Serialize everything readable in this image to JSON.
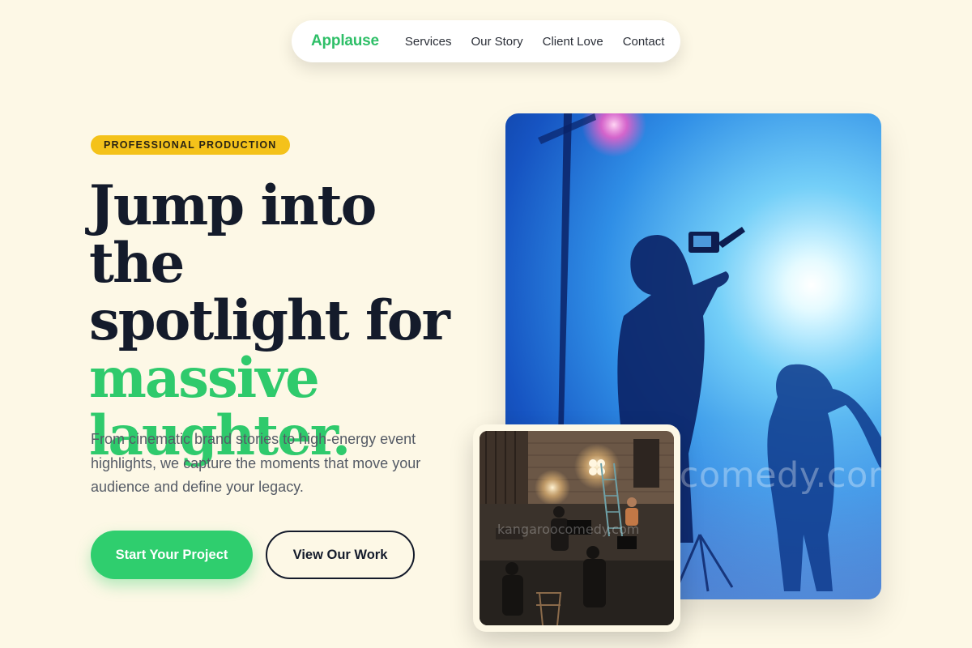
{
  "nav": {
    "brand": "Applause",
    "links": [
      "Services",
      "Our Story",
      "Client Love",
      "Contact"
    ]
  },
  "hero": {
    "badge": "PROFESSIONAL PRODUCTION",
    "headline": {
      "line1": "Jump into the",
      "line2": "spotlight for",
      "accent1": "massive",
      "accent2": "laughter."
    },
    "lead": "From cinematic brand stories to high-energy event highlights, we capture the moments that move your audience and define your legacy.",
    "primary_cta": "Start Your Project",
    "secondary_cta": "View Our Work"
  },
  "media": {
    "main_photo_watermark": "kangaroocomedy.com",
    "small_photo_watermark": "kangaroocomedy.com"
  },
  "colors": {
    "background": "#fdf8e6",
    "brand_green": "#2fce6e",
    "badge_yellow": "#f4c21a",
    "heading_dark": "#141b2b",
    "body_text": "#555b66"
  }
}
